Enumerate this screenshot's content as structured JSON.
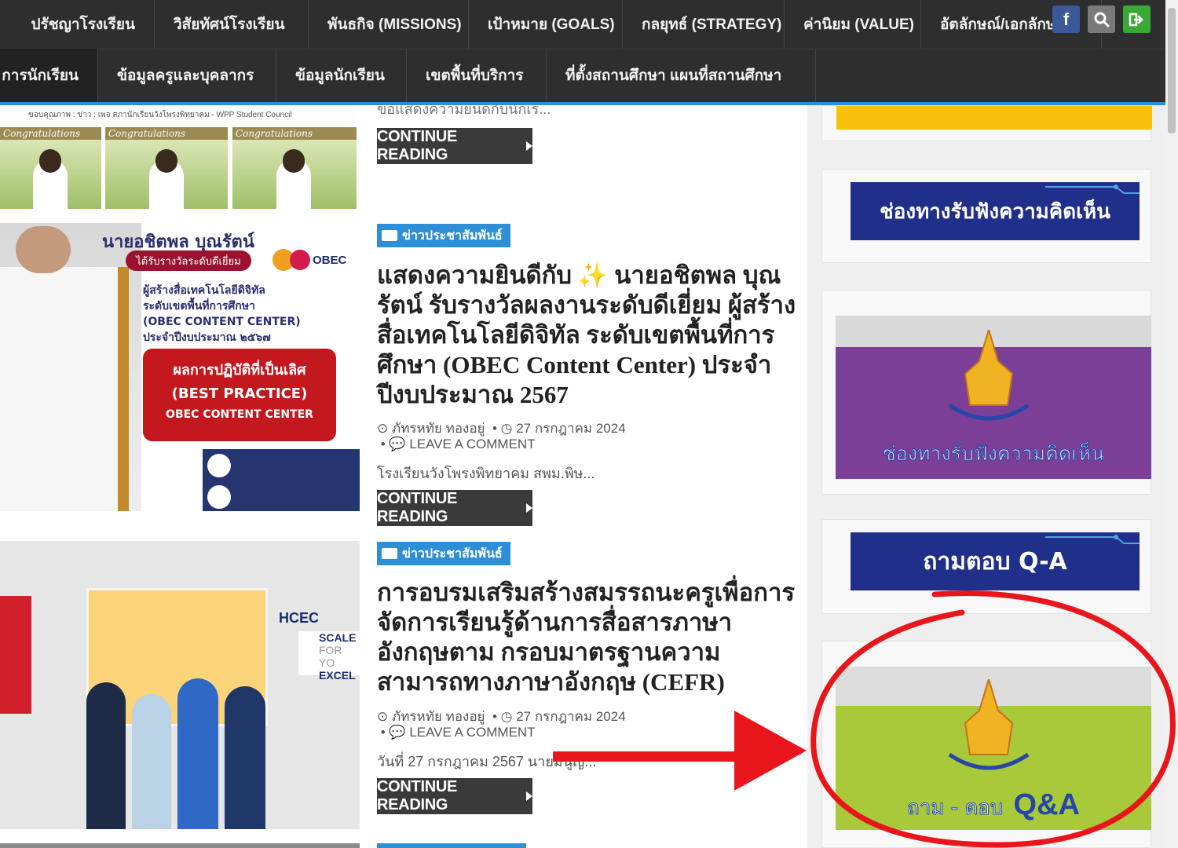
{
  "nav": {
    "row1": [
      "ปรัชญาโรงเรียน",
      "วิสัยทัศน์โรงเรียน",
      "พันธกิจ (MISSIONS)",
      "เป้าหมาย (GOALS)",
      "กลยุทธ์ (STRATEGY)",
      "ค่านิยม (VALUE)",
      "อัตลักษณ์/เอกลักษ"
    ],
    "row2": [
      "การนักเรียน",
      "ข้อมูลครูและบุคลากร",
      "ข้อมูลนักเรียน",
      "เขตพื้นที่บริการ",
      "ที่ตั้งสถานศึกษา แผนที่สถานศึกษา"
    ],
    "social": {
      "facebook": "f",
      "search_icon": "search-icon",
      "login_icon": "login-icon",
      "colors": {
        "facebook": "#3b5998",
        "search": "#7a7a7a",
        "login": "#3aa835"
      }
    }
  },
  "posts": [
    {
      "excerpt": "ขอแสดงความยินดีกับนักเรี...",
      "button": "CONTINUE READING",
      "thumb": {
        "credit": "ขอบคุณภาพ : ข่าว : เพจ สภานักเรียนวังโพรงพิทยาคม - WPP Student Council",
        "cards": [
          "Congratulations",
          "Congratulations",
          "Congratulations"
        ]
      }
    },
    {
      "category": "ข่าวประชาสัมพันธ์",
      "title": "แสดงความยินดีกับ ✨ นายอชิตพล บุณรัตน์ รับรางวัลผลงานระดับดีเยี่ยม ผู้สร้างสื่อเทคโนโลยีดิจิทัล ระดับเขตพื้นที่การศึกษา (OBEC Content Center) ประจำปีงบประมาณ 2567",
      "author": "ภัทรหทัย ทองอยู่",
      "date": "27 กรกฎาคม 2024",
      "comment": "LEAVE A COMMENT",
      "excerpt": "โรงเรียนวังโพรงพิทยาคม สพม.พิษ...",
      "button": "CONTINUE READING",
      "thumb": {
        "name": "นายอชิตพล บุณรัตน์",
        "award": "ได้รับรางวัลระดับดีเยี่ยม",
        "logo": "OBEC",
        "lines": [
          "ผู้สร้างสื่อเทคโนโลยีดิจิทัล",
          "ระดับเขตพื้นที่การศึกษา",
          "(OBEC CONTENT CENTER)",
          "ประจำปีงบประมาณ ๒๕๖๗"
        ],
        "box": [
          "ผลการปฏิบัติที่เป็นเลิศ",
          "(BEST PRACTICE)",
          "OBEC CONTENT CENTER"
        ]
      }
    },
    {
      "category": "ข่าวประชาสัมพันธ์",
      "title": "การอบรมเสริมสร้างสมรรถนะครูเพื่อการจัดการเรียนรู้ด้านการสื่อสารภาษาอังกฤษตาม กรอบมาตรฐานความสามารถทางภาษาอังกฤษ (CEFR)",
      "author": "ภัทรหทัย ทองอยู่",
      "date": "27 กรกฎาคม 2024",
      "comment": "LEAVE A COMMENT",
      "excerpt": "วันที่ 27 กรกฎาคม 2567 นายมนูญ...",
      "button": "CONTINUE READING",
      "thumb": {
        "logo": "HCEC",
        "scale": [
          "SCALE",
          "FOR YO",
          "EXCEL"
        ]
      }
    }
  ],
  "sidebar": {
    "feedback_title": "ช่องทางรับฟังความคิดเห็น",
    "feedback_banner": "ช่องทางรับฟังความคิดเห็น",
    "qa_title": "ถามตอบ Q-A",
    "qa_banner_thai": "ถาม - ตอบ",
    "qa_banner_en": "Q&A"
  },
  "colors": {
    "accent": "#2e8ed6",
    "navbar": "#2e2e2e",
    "button": "#3a3a3a",
    "purple": "#7b3f98",
    "lime": "#a8c93a",
    "banner_navy": "#1f2f8a",
    "annotation": "#e8161b"
  }
}
